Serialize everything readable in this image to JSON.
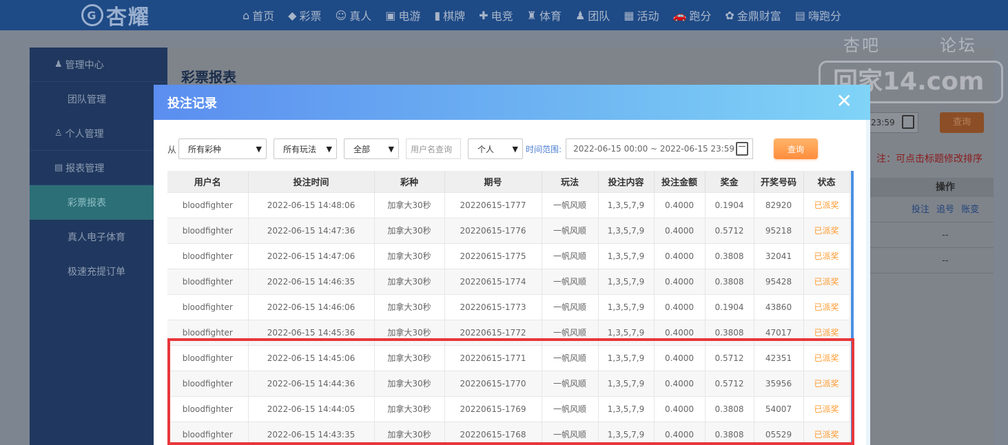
{
  "topnav": {
    "logo_text": "杏耀",
    "items": [
      {
        "icon": "home-icon",
        "glyph": "⌂",
        "label": "首页"
      },
      {
        "icon": "lottery-icon",
        "glyph": "◆",
        "label": "彩票"
      },
      {
        "icon": "live-icon",
        "glyph": "☺",
        "label": "真人"
      },
      {
        "icon": "slot-icon",
        "glyph": "▣",
        "label": "电游"
      },
      {
        "icon": "cards-icon",
        "glyph": "▮",
        "label": "棋牌"
      },
      {
        "icon": "gamepad-icon",
        "glyph": "✚",
        "label": "电竞"
      },
      {
        "icon": "trophy-icon",
        "glyph": "♜",
        "label": "体育"
      },
      {
        "icon": "team-icon",
        "glyph": "♟",
        "label": "团队"
      },
      {
        "icon": "gift-icon",
        "glyph": "▦",
        "label": "活动"
      },
      {
        "icon": "car-icon",
        "glyph": "🚗",
        "label": "跑分"
      },
      {
        "icon": "money-icon",
        "glyph": "✿",
        "label": "金鼎财富"
      },
      {
        "icon": "hi-icon",
        "glyph": "▤",
        "label": "嗨跑分"
      }
    ]
  },
  "sidebar": {
    "items": [
      {
        "type": "head",
        "icon": "group-icon",
        "glyph": "♟",
        "label": "管理中心"
      },
      {
        "type": "sub",
        "label": "团队管理"
      },
      {
        "type": "head",
        "icon": "user-icon",
        "glyph": "♙",
        "label": "个人管理"
      },
      {
        "type": "head",
        "icon": "report-icon",
        "glyph": "▤",
        "label": "报表管理"
      },
      {
        "type": "sub",
        "label": "彩票报表",
        "active": true
      },
      {
        "type": "sub",
        "label": "真人电子体育"
      },
      {
        "type": "sub",
        "label": "极速充提订单"
      }
    ]
  },
  "background": {
    "title": "彩票报表",
    "date_fragment": "23:59",
    "search_label": "查询",
    "note": "注：可点击标题修改排序",
    "table_header": "操作",
    "row1_links": [
      "投注",
      "追号",
      "账变"
    ],
    "row2": "--",
    "row3": "--"
  },
  "watermark": {
    "top_left": "杏吧",
    "top_right": "论坛",
    "main": "回家14.com"
  },
  "modal": {
    "title": "投注记录",
    "close": "✕",
    "filters": {
      "from_label": "从",
      "lottery_select": "所有彩种",
      "play_select": "所有玩法",
      "status_select": "全部",
      "username_placeholder": "用户名查询",
      "scope_select": "个人",
      "range_label": "时间范围:",
      "date_range": "2022-06-15 00:00 ~ 2022-06-15 23:59",
      "search_button": "查询"
    },
    "columns": [
      "用户名",
      "投注时间",
      "彩种",
      "期号",
      "玩法",
      "投注内容",
      "投注金额",
      "奖金",
      "开奖号码",
      "状态"
    ],
    "rows": [
      [
        "bloodfighter",
        "2022-06-15 14:48:06",
        "加拿大30秒",
        "20220615-1777",
        "一帆风顺",
        "1,3,5,7,9",
        "0.4000",
        "0.1904",
        "82920",
        "已派奖"
      ],
      [
        "bloodfighter",
        "2022-06-15 14:47:36",
        "加拿大30秒",
        "20220615-1776",
        "一帆风顺",
        "1,3,5,7,9",
        "0.4000",
        "0.5712",
        "95218",
        "已派奖"
      ],
      [
        "bloodfighter",
        "2022-06-15 14:47:06",
        "加拿大30秒",
        "20220615-1775",
        "一帆风顺",
        "1,3,5,7,9",
        "0.4000",
        "0.3808",
        "32041",
        "已派奖"
      ],
      [
        "bloodfighter",
        "2022-06-15 14:46:35",
        "加拿大30秒",
        "20220615-1774",
        "一帆风顺",
        "1,3,5,7,9",
        "0.4000",
        "0.3808",
        "95428",
        "已派奖"
      ],
      [
        "bloodfighter",
        "2022-06-15 14:46:06",
        "加拿大30秒",
        "20220615-1773",
        "一帆风顺",
        "1,3,5,7,9",
        "0.4000",
        "0.1904",
        "43860",
        "已派奖"
      ],
      [
        "bloodfighter",
        "2022-06-15 14:45:36",
        "加拿大30秒",
        "20220615-1772",
        "一帆风顺",
        "1,3,5,7,9",
        "0.4000",
        "0.3808",
        "47017",
        "已派奖"
      ],
      [
        "bloodfighter",
        "2022-06-15 14:45:06",
        "加拿大30秒",
        "20220615-1771",
        "一帆风顺",
        "1,3,5,7,9",
        "0.4000",
        "0.5712",
        "42351",
        "已派奖"
      ],
      [
        "bloodfighter",
        "2022-06-15 14:44:36",
        "加拿大30秒",
        "20220615-1770",
        "一帆风顺",
        "1,3,5,7,9",
        "0.4000",
        "0.5712",
        "35956",
        "已派奖"
      ],
      [
        "bloodfighter",
        "2022-06-15 14:44:05",
        "加拿大30秒",
        "20220615-1769",
        "一帆风顺",
        "1,3,5,7,9",
        "0.4000",
        "0.3808",
        "54007",
        "已派奖"
      ],
      [
        "bloodfighter",
        "2022-06-15 14:43:35",
        "加拿大30秒",
        "20220615-1768",
        "一帆风顺",
        "1,3,5,7,9",
        "0.4000",
        "0.3808",
        "05529",
        "已派奖"
      ]
    ]
  },
  "colors": {
    "accent_blue": "#5b8ef0",
    "status_orange": "#ff9a2e",
    "highlight_red": "#e8373b",
    "button_orange": "#ff8d3c"
  }
}
